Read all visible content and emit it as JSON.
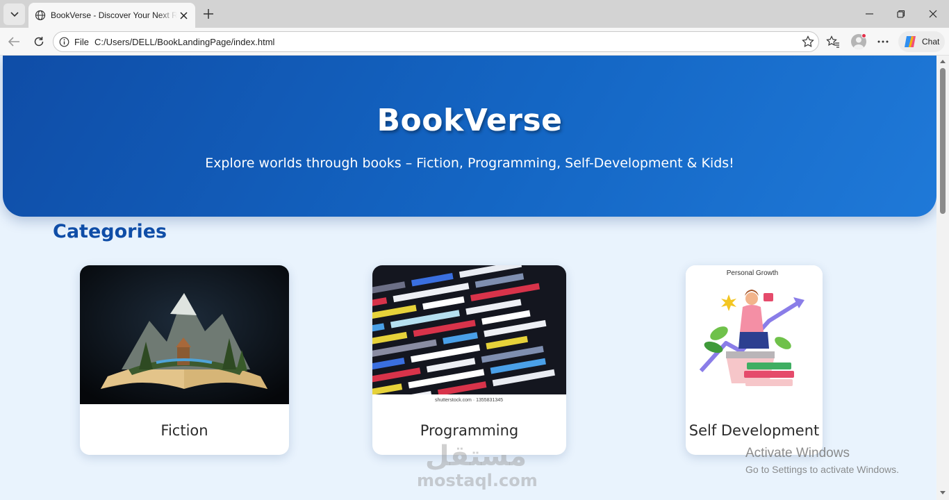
{
  "browser": {
    "tab_title": "BookVerse - Discover Your Next Read",
    "url_scheme": "File",
    "url": "C:/Users/DELL/BookLandingPage/index.html",
    "chat_label": "Chat"
  },
  "hero": {
    "title": "BookVerse",
    "subtitle": "Explore worlds through books – Fiction, Programming, Self-Development & Kids!"
  },
  "categories": {
    "heading": "Categories",
    "items": [
      {
        "label": "Fiction"
      },
      {
        "label": "Programming",
        "image_caption": "shutterstock.com · 1355831345"
      },
      {
        "label": "Self Development",
        "image_caption": "Personal Growth"
      }
    ]
  },
  "overlays": {
    "watermark_ar": "مستقل",
    "watermark_en": "mostaql.com",
    "activation_title": "Activate Windows",
    "activation_sub": "Go to Settings to activate Windows."
  },
  "colors": {
    "hero_start": "#0f4da7",
    "hero_end": "#1f79d8",
    "heading": "#0f4da7",
    "page_bg": "#e9f3fd"
  }
}
